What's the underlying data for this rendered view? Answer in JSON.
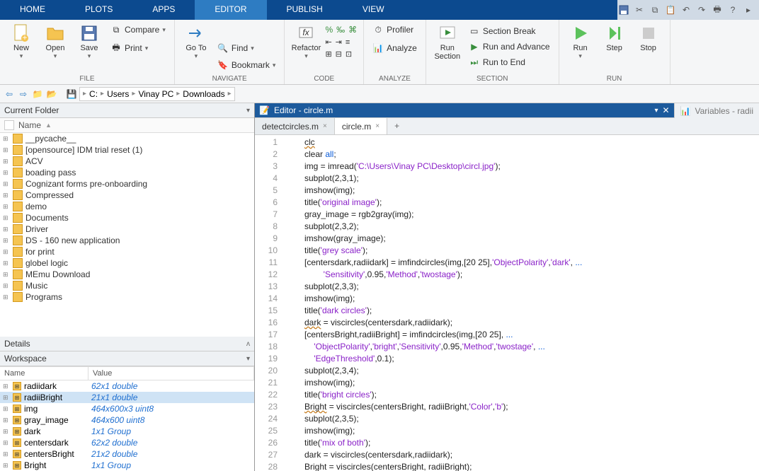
{
  "tabs": [
    "HOME",
    "PLOTS",
    "APPS",
    "EDITOR",
    "PUBLISH",
    "VIEW"
  ],
  "active_tab": 3,
  "ribbon": {
    "file": {
      "new": "New",
      "open": "Open",
      "save": "Save",
      "compare": "Compare",
      "print": "Print",
      "title": "FILE"
    },
    "nav": {
      "goto": "Go To",
      "find": "Find",
      "bookmark": "Bookmark",
      "title": "NAVIGATE"
    },
    "code": {
      "refactor": "Refactor",
      "title": "CODE"
    },
    "analyze": {
      "profiler": "Profiler",
      "analyze": "Analyze",
      "title": "ANALYZE"
    },
    "section": {
      "run_section": "Run\nSection",
      "break": "Section Break",
      "advance": "Run and Advance",
      "toend": "Run to End",
      "title": "SECTION"
    },
    "run": {
      "run": "Run",
      "step": "Step",
      "stop": "Stop",
      "title": "RUN"
    }
  },
  "path": [
    "C:",
    "Users",
    "Vinay PC",
    "Downloads"
  ],
  "current_folder": {
    "title": "Current Folder",
    "col": "Name",
    "items": [
      "__pycache__",
      "[opensource] IDM trial reset (1)",
      "ACV",
      "boading pass",
      "Cognizant forms pre-onboarding",
      "Compressed",
      "demo",
      "Documents",
      "Driver",
      "DS - 160 new application",
      "for print",
      "globel logic",
      "MEmu Download",
      "Music",
      "Programs"
    ]
  },
  "details": {
    "title": "Details"
  },
  "workspace": {
    "title": "Workspace",
    "cols": [
      "Name",
      "Value"
    ],
    "rows": [
      {
        "n": "radiidark",
        "v": "62x1 double"
      },
      {
        "n": "radiiBright",
        "v": "21x1 double",
        "sel": true
      },
      {
        "n": "img",
        "v": "464x600x3 uint8"
      },
      {
        "n": "gray_image",
        "v": "464x600 uint8"
      },
      {
        "n": "dark",
        "v": "1x1 Group"
      },
      {
        "n": "centersdark",
        "v": "62x2 double"
      },
      {
        "n": "centersBright",
        "v": "21x2 double"
      },
      {
        "n": "Bright",
        "v": "1x1 Group"
      }
    ]
  },
  "editor": {
    "title": "Editor - circle.m",
    "variables": "Variables - radii",
    "files": [
      {
        "name": "detectcircles.m"
      },
      {
        "name": "circle.m",
        "active": true
      }
    ],
    "start_line": 1,
    "lines": [
      [
        [
          "clc",
          "u"
        ]
      ],
      [
        [
          "clear ",
          ""
        ],
        [
          "all",
          "kw"
        ],
        [
          ";",
          ""
        ]
      ],
      [
        [
          "img = imread(",
          ""
        ],
        [
          "'C:\\Users\\Vinay PC\\Desktop\\circl.jpg'",
          "str"
        ],
        [
          ");",
          ""
        ]
      ],
      [
        [
          "subplot(2,3,1);",
          ""
        ]
      ],
      [
        [
          "imshow(img);",
          ""
        ]
      ],
      [
        [
          "title(",
          ""
        ],
        [
          "'original image'",
          "str"
        ],
        [
          ");",
          ""
        ]
      ],
      [
        [
          "gray_image = rgb2gray(img);",
          ""
        ]
      ],
      [
        [
          "subplot(2,3,2);",
          ""
        ]
      ],
      [
        [
          "imshow(gray_image);",
          ""
        ]
      ],
      [
        [
          "title(",
          ""
        ],
        [
          "'grey scale'",
          "str"
        ],
        [
          ");",
          ""
        ]
      ],
      [
        [
          "[centersdark,radiidark] = imfindcircles(img,[20 25],",
          ""
        ],
        [
          "'ObjectPolarity'",
          "str"
        ],
        [
          ",",
          ""
        ],
        [
          "'dark'",
          "str"
        ],
        [
          ", ",
          ""
        ],
        [
          "...",
          "kw"
        ]
      ],
      [
        [
          "        ",
          ""
        ],
        [
          "'Sensitivity'",
          "str"
        ],
        [
          ",0.95,",
          ""
        ],
        [
          "'Method'",
          "str"
        ],
        [
          ",",
          ""
        ],
        [
          "'twostage'",
          "str"
        ],
        [
          ");",
          ""
        ]
      ],
      [
        [
          "subplot(2,3,3);",
          ""
        ]
      ],
      [
        [
          "imshow(img);",
          ""
        ]
      ],
      [
        [
          "title(",
          ""
        ],
        [
          "'dark circles'",
          "str"
        ],
        [
          ");",
          ""
        ]
      ],
      [
        [
          "dark",
          "u"
        ],
        [
          " = viscircles(centersdark,radiidark);",
          ""
        ]
      ],
      [
        [
          "[centersBright,radiiBright] = imfindcircles(img,[20 25], ",
          ""
        ],
        [
          "...",
          "kw"
        ]
      ],
      [
        [
          "    ",
          ""
        ],
        [
          "'ObjectPolarity'",
          "str"
        ],
        [
          ",",
          ""
        ],
        [
          "'bright'",
          "str"
        ],
        [
          ",",
          ""
        ],
        [
          "'Sensitivity'",
          "str"
        ],
        [
          ",0.95,",
          ""
        ],
        [
          "'Method'",
          "str"
        ],
        [
          ",",
          ""
        ],
        [
          "'twostage'",
          "str"
        ],
        [
          ", ",
          ""
        ],
        [
          "...",
          "kw"
        ]
      ],
      [
        [
          "    ",
          ""
        ],
        [
          "'EdgeThreshold'",
          "str"
        ],
        [
          ",0.1);",
          ""
        ]
      ],
      [
        [
          "subplot(2,3,4);",
          ""
        ]
      ],
      [
        [
          "imshow(img);",
          ""
        ]
      ],
      [
        [
          "title(",
          ""
        ],
        [
          "'bright circles'",
          "str"
        ],
        [
          ");",
          ""
        ]
      ],
      [
        [
          "Bright",
          "u"
        ],
        [
          " = viscircles(centersBright, radiiBright,",
          ""
        ],
        [
          "'Color'",
          "str"
        ],
        [
          ",",
          ""
        ],
        [
          "'b'",
          "str"
        ],
        [
          ");",
          ""
        ]
      ],
      [
        [
          "subplot(2,3,5);",
          ""
        ]
      ],
      [
        [
          "imshow(img);",
          ""
        ]
      ],
      [
        [
          "title(",
          ""
        ],
        [
          "'mix of both'",
          "str"
        ],
        [
          ");",
          ""
        ]
      ],
      [
        [
          "dark = viscircles(centersdark,radiidark);",
          ""
        ]
      ],
      [
        [
          "Bright = viscircles(centersBright, radiiBright);",
          ""
        ]
      ]
    ]
  }
}
